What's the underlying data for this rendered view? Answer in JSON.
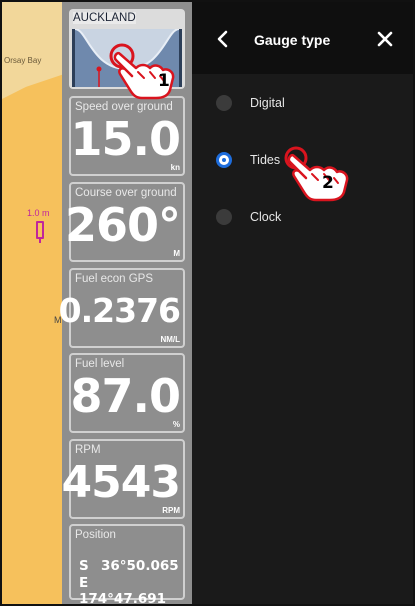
{
  "map": {
    "place_label": "Orsay Bay",
    "depth_label": "1.0 m",
    "edge_label": "M"
  },
  "tide": {
    "location": "AUCKLAND"
  },
  "gauges": {
    "speed": {
      "label": "Speed over ground",
      "value": "15.0",
      "unit": "kn"
    },
    "course": {
      "label": "Course over ground",
      "value": "260°",
      "unit": "M"
    },
    "fuel_econ": {
      "label": "Fuel econ GPS",
      "value": "0.2376",
      "unit": "NM/L"
    },
    "fuel_level": {
      "label": "Fuel level",
      "value": "87.0",
      "unit": "%"
    },
    "rpm": {
      "label": "RPM",
      "value": "4543",
      "unit": "RPM"
    },
    "position": {
      "label": "Position",
      "lat_dir": "S",
      "lat_value": "36°50.065",
      "lon_dir": "E",
      "lon_value": "174°47.691"
    }
  },
  "panel": {
    "title": "Gauge type",
    "options": [
      {
        "label": "Digital",
        "selected": false
      },
      {
        "label": "Tides",
        "selected": true
      },
      {
        "label": "Clock",
        "selected": false
      }
    ]
  },
  "callouts": {
    "step1": "1",
    "step2": "2"
  },
  "colors": {
    "panel_bg": "#1a1a1a",
    "gauge_bg": "#8e8e8e",
    "radio_selected": "#1e6ddc",
    "callout_red": "#d9141e",
    "map_land": "#f6c15c"
  }
}
